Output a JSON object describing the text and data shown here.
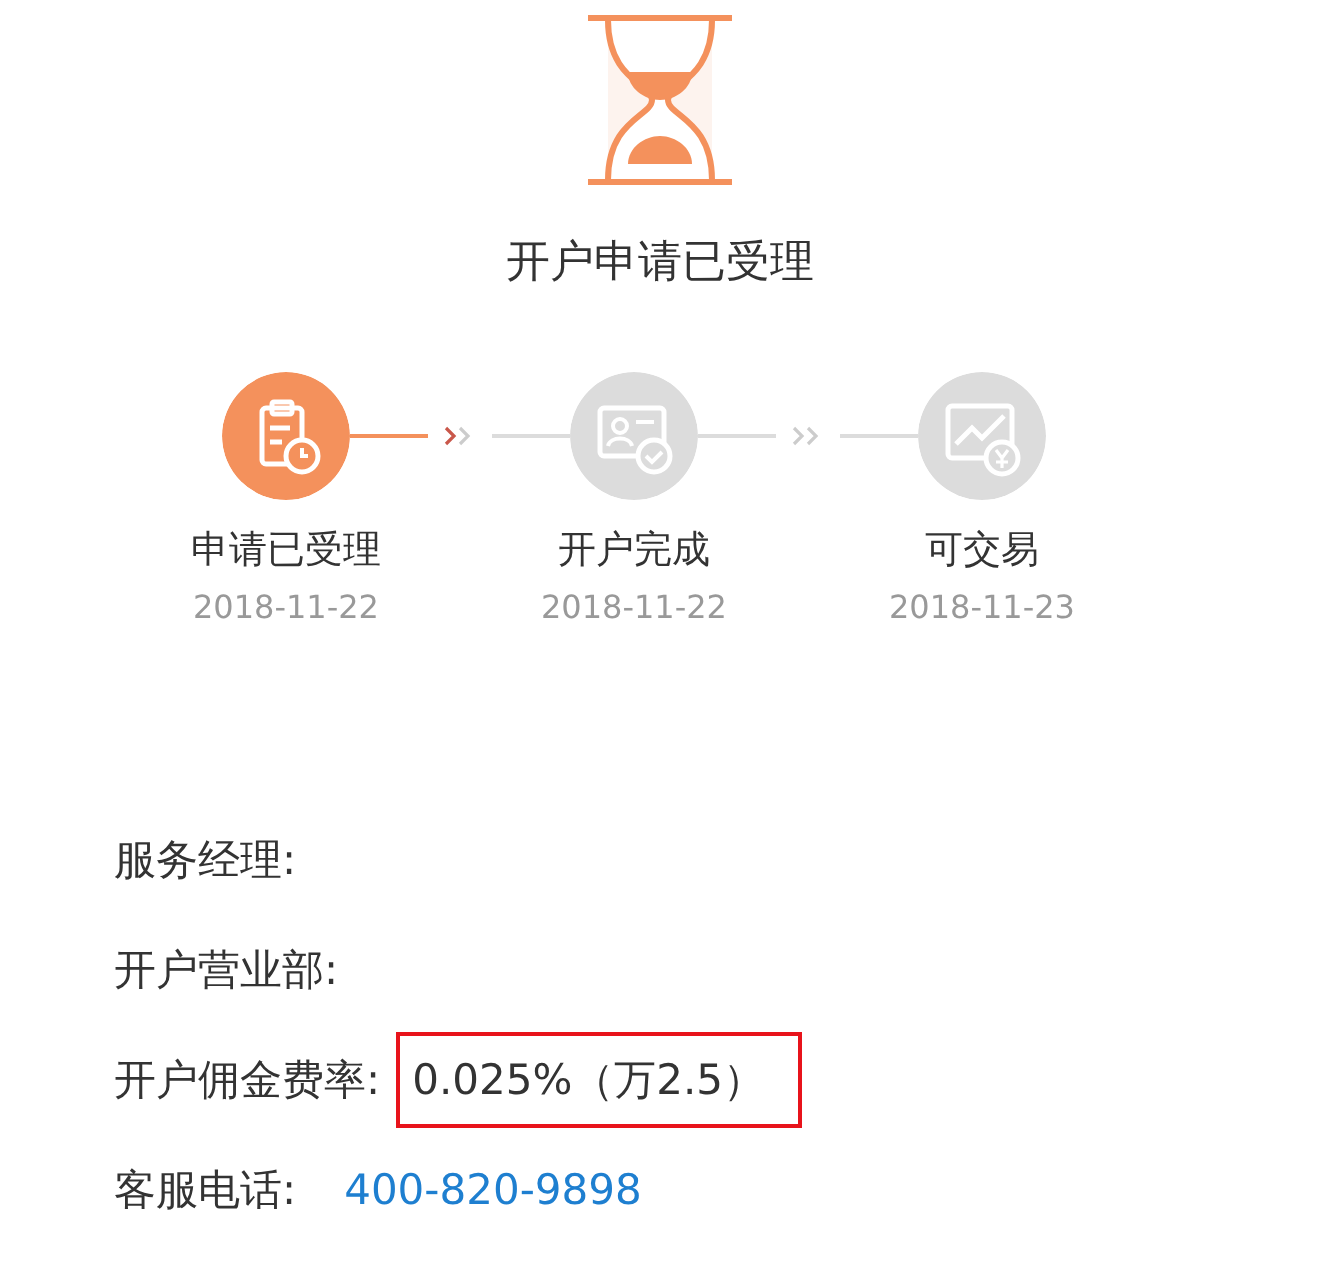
{
  "status": {
    "title": "开户申请已受理"
  },
  "steps": [
    {
      "kind": "clipboard",
      "label": "申请已受理",
      "date": "2018-11-22",
      "active": true
    },
    {
      "kind": "card",
      "label": "开户完成",
      "date": "2018-11-22",
      "active": false
    },
    {
      "kind": "chart",
      "label": "可交易",
      "date": "2018-11-23",
      "active": false
    }
  ],
  "details": [
    {
      "label": "服务经理:",
      "highlighted": false
    },
    {
      "label": "开户营业部:",
      "highlighted": false
    },
    {
      "label": "开户佣金费率:",
      "value": "0.025%（万2.5）",
      "kind": "plain",
      "highlighted": true
    },
    {
      "label": "客服电话:",
      "value": "400-820-9898",
      "kind": "link",
      "highlighted": false
    }
  ]
}
